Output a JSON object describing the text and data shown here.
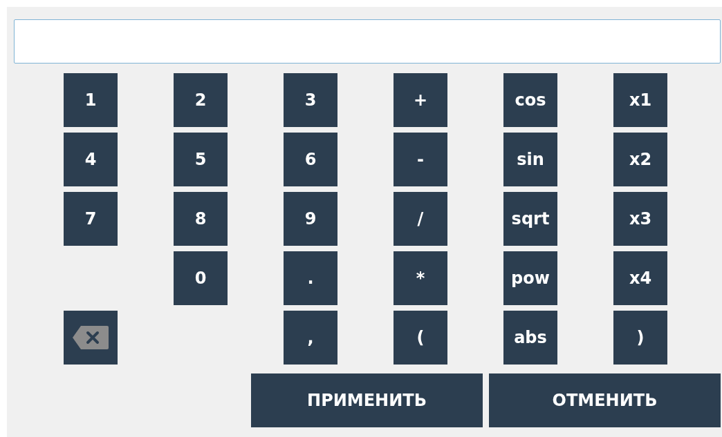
{
  "input": {
    "kind": "text"
  },
  "keypad": [
    [
      {
        "kind": "key",
        "label": "1"
      },
      {
        "kind": "key",
        "label": "2"
      },
      {
        "kind": "key",
        "label": "3"
      },
      {
        "kind": "key",
        "label": "+"
      },
      {
        "kind": "key",
        "label": "cos"
      },
      {
        "kind": "key",
        "label": "x1"
      }
    ],
    [
      {
        "kind": "key",
        "label": "4"
      },
      {
        "kind": "key",
        "label": "5"
      },
      {
        "kind": "key",
        "label": "6"
      },
      {
        "kind": "key",
        "label": "-"
      },
      {
        "kind": "key",
        "label": "sin"
      },
      {
        "kind": "key",
        "label": "x2"
      }
    ],
    [
      {
        "kind": "key",
        "label": "7"
      },
      {
        "kind": "key",
        "label": "8"
      },
      {
        "kind": "key",
        "label": "9"
      },
      {
        "kind": "key",
        "label": "/"
      },
      {
        "kind": "key",
        "label": "sqrt"
      },
      {
        "kind": "key",
        "label": "x3"
      }
    ],
    [
      {
        "kind": "blank"
      },
      {
        "kind": "key",
        "label": "0"
      },
      {
        "kind": "key",
        "label": "."
      },
      {
        "kind": "key",
        "label": "*"
      },
      {
        "kind": "key",
        "label": "pow"
      },
      {
        "kind": "key",
        "label": "x4"
      }
    ],
    [
      {
        "kind": "backspace"
      },
      {
        "kind": "blank"
      },
      {
        "kind": "key",
        "label": ","
      },
      {
        "kind": "key",
        "label": "("
      },
      {
        "kind": "key",
        "label": "abs"
      },
      {
        "kind": "key",
        "label": ")"
      }
    ]
  ],
  "buttons": [
    "ПРИМЕНИТЬ",
    "ОТМЕНИТЬ"
  ]
}
